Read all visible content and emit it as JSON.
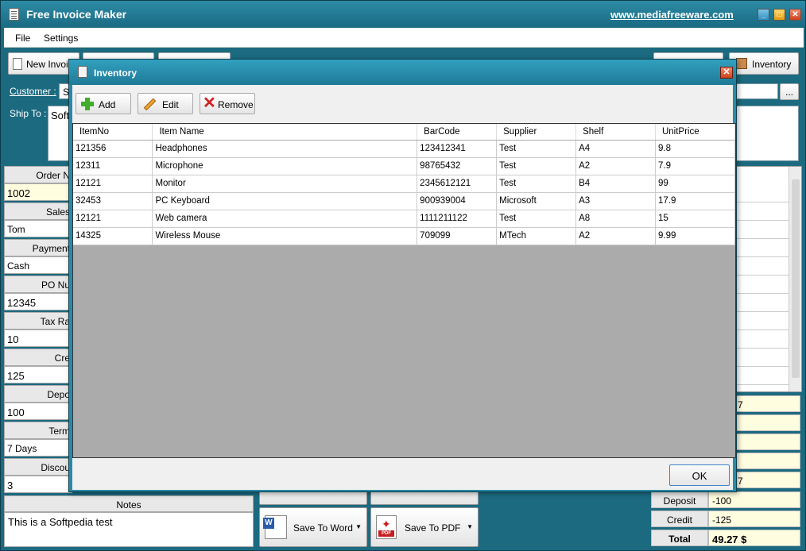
{
  "window": {
    "title": "Free Invoice Maker",
    "url": "www.mediafreeware.com",
    "min_glyph": "_",
    "max_glyph": "□",
    "close_glyph": "✕"
  },
  "menu": {
    "file": "File",
    "settings": "Settings"
  },
  "toolbar": {
    "new_invoice": "New Invoic",
    "inventory": "Inventory"
  },
  "customer": {
    "label": "Customer :",
    "value": "S",
    "browse": "..."
  },
  "ship_to": {
    "label": "Ship To :",
    "value": "Soft"
  },
  "fields": [
    {
      "label": "Order N",
      "value": "1002"
    },
    {
      "label": "Sales",
      "value": "Tom"
    },
    {
      "label": "Payment",
      "value": "Cash"
    },
    {
      "label": "PO Nu",
      "value": "12345"
    },
    {
      "label": "Tax Ra",
      "value": "10"
    },
    {
      "label": "Cre",
      "value": "125"
    },
    {
      "label": "Depo",
      "value": "100"
    },
    {
      "label": "Term",
      "value": "7 Days"
    },
    {
      "label": "Discou",
      "value": "3"
    }
  ],
  "notes": {
    "label": "Notes",
    "value": "This is a Softpedia test"
  },
  "save": {
    "word": "Save To Word",
    "pdf": "Save To PDF",
    "dropdown_glyph": "▼"
  },
  "summary": {
    "partial_1": "7",
    "partial_2": "7",
    "deposit_label": "Deposit",
    "deposit_value": "-100",
    "credit_label": "Credit",
    "credit_value": "-125",
    "total_label": "Total",
    "total_value": "49.27 $"
  },
  "dialog": {
    "title": "Inventory",
    "close_glyph": "✕",
    "buttons": {
      "add": "Add",
      "edit": "Edit",
      "remove": "Remove",
      "ok": "OK"
    },
    "columns": [
      "ItemNo",
      "Item Name",
      "BarCode",
      "Supplier",
      "Shelf",
      "UnitPrice"
    ],
    "rows": [
      [
        "121356",
        "Headphones",
        "123412341",
        "Test",
        "A4",
        "9.8"
      ],
      [
        "12311",
        "Microphone",
        "98765432",
        "Test",
        "A2",
        "7.9"
      ],
      [
        "12121",
        "Monitor",
        "2345612121",
        "Test",
        "B4",
        "99"
      ],
      [
        "32453",
        "PC Keyboard",
        "900939004",
        "Microsoft",
        "A3",
        "17.9"
      ],
      [
        "12121",
        "Web camera",
        "1111211122",
        "Test",
        "A8",
        "15"
      ],
      [
        "14325",
        "Wireless Mouse",
        "709099",
        "MTech",
        "A2",
        "9.99"
      ]
    ]
  }
}
